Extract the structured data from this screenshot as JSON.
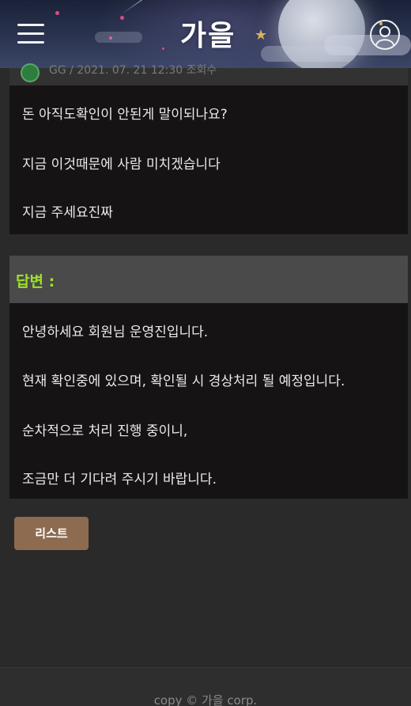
{
  "header": {
    "logo_text": "가을",
    "icons": {
      "menu": "hamburger-menu-icon",
      "user": "user-profile-icon"
    }
  },
  "question": {
    "meta_text": "GG  /  2021. 07. 21 12:30 조회수",
    "lines": [
      "돈 아직도확인이 안된게 말이되나요?",
      "지금 이것때문에 사람 미치겠습니다",
      "지금 주세요진짜"
    ]
  },
  "answer": {
    "label": "답변 :",
    "lines": [
      "안녕하세요 회원님 운영진입니다.",
      "현재 확인중에 있으며, 확인될 시 경상처리 될 예정입니다.",
      "순차적으로 처리 진행 중이니,",
      "조금만 더 기다려 주시기 바랍니다."
    ]
  },
  "actions": {
    "list_button": "리스트"
  },
  "footer": {
    "copyright": "copy © 가을 corp."
  },
  "colors": {
    "answer_label": "#9ee12a",
    "list_button_bg": "#8c6b50",
    "content_bg": "#151314",
    "page_bg": "#2a2a2a"
  }
}
